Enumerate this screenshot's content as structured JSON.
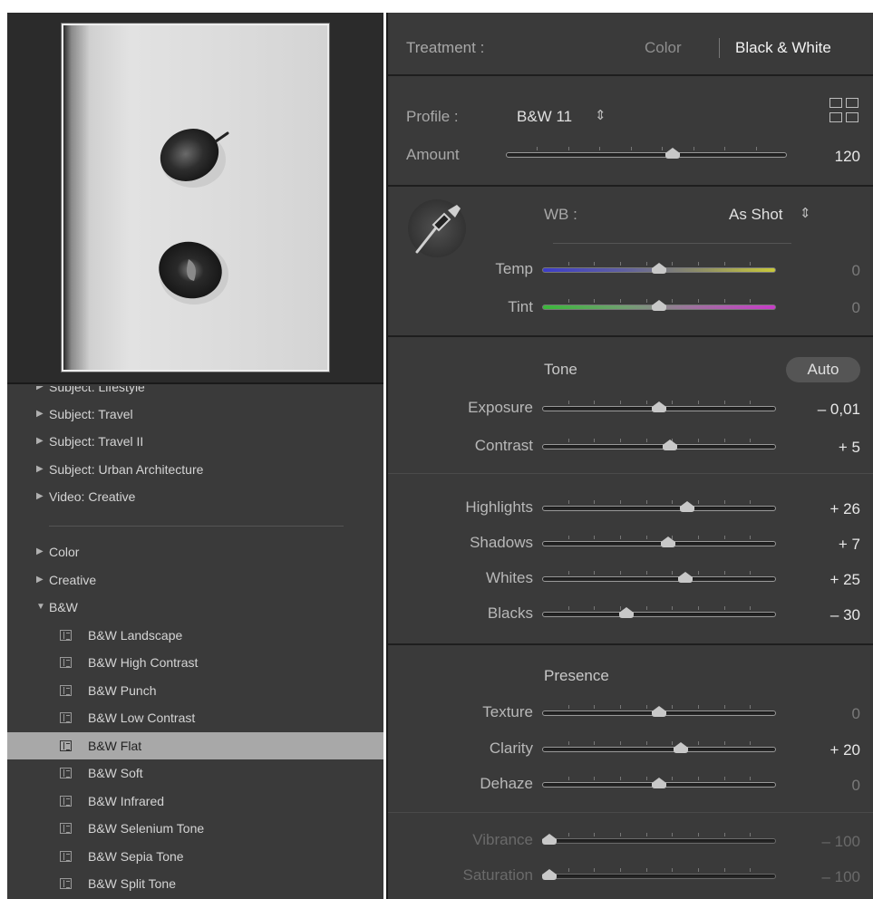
{
  "left_panel": {
    "preset_list": {
      "top_items": [
        {
          "label": "Subject: Lifestyle",
          "expanded": false
        },
        {
          "label": "Subject: Travel",
          "expanded": false
        },
        {
          "label": "Subject: Travel II",
          "expanded": false
        },
        {
          "label": "Subject: Urban Architecture",
          "expanded": false
        },
        {
          "label": "Video: Creative",
          "expanded": false
        }
      ],
      "groups": [
        {
          "label": "Color",
          "expanded": false
        },
        {
          "label": "Creative",
          "expanded": false
        },
        {
          "label": "B&W",
          "expanded": true
        }
      ],
      "bw_presets": [
        {
          "label": "B&W Landscape"
        },
        {
          "label": "B&W High Contrast"
        },
        {
          "label": "B&W Punch"
        },
        {
          "label": "B&W Low Contrast"
        },
        {
          "label": "B&W Flat",
          "selected": true
        },
        {
          "label": "B&W Soft"
        },
        {
          "label": "B&W Infrared"
        },
        {
          "label": "B&W Selenium Tone"
        },
        {
          "label": "B&W Sepia Tone"
        },
        {
          "label": "B&W Split Tone"
        }
      ],
      "icons": {
        "collapsed": "triangle-right-icon",
        "expanded": "triangle-down-icon",
        "preset": "preset-icon"
      }
    }
  },
  "right_panel": {
    "treatment": {
      "label": "Treatment :",
      "options": [
        "Color",
        "Black & White"
      ],
      "selected": "Black & White"
    },
    "profile": {
      "label": "Profile :",
      "value": "B&W 11",
      "value_icon": "up-down-arrows-icon",
      "grid_icon": "profile-browser-grid-icon"
    },
    "amount": {
      "label": "Amount",
      "value": "120",
      "position": 0.6
    },
    "wb": {
      "label": "WB :",
      "value": "As Shot",
      "value_icon": "up-down-arrows-icon",
      "tool_icon": "eyedropper-icon"
    },
    "temp": {
      "label": "Temp",
      "value": "0",
      "position": 0.5
    },
    "tint": {
      "label": "Tint",
      "value": "0",
      "position": 0.5
    },
    "tone": {
      "title": "Tone",
      "auto_label": "Auto"
    },
    "exposure": {
      "label": "Exposure",
      "value": "– 0,01",
      "position": 0.5
    },
    "contrast": {
      "label": "Contrast",
      "value": "+ 5",
      "position": 0.55
    },
    "highlights": {
      "label": "Highlights",
      "value": "+ 26",
      "position": 0.63
    },
    "shadows": {
      "label": "Shadows",
      "value": "+ 7",
      "position": 0.54
    },
    "whites": {
      "label": "Whites",
      "value": "+ 25",
      "position": 0.62
    },
    "blacks": {
      "label": "Blacks",
      "value": "– 30",
      "position": 0.35
    },
    "presence": {
      "title": "Presence"
    },
    "texture": {
      "label": "Texture",
      "value": "0",
      "position": 0.5
    },
    "clarity": {
      "label": "Clarity",
      "value": "+ 20",
      "position": 0.6
    },
    "dehaze": {
      "label": "Dehaze",
      "value": "0",
      "position": 0.5
    },
    "vibrance": {
      "label": "Vibrance",
      "value": "– 100",
      "position": 0.0
    },
    "saturation": {
      "label": "Saturation",
      "value": "– 100",
      "position": 0.0
    }
  },
  "colors": {
    "panel_bg": "#3a3a3a",
    "selected_row": "#a8a8a8",
    "text": "#b8b8b8",
    "value_text": "#e8e8e8"
  }
}
